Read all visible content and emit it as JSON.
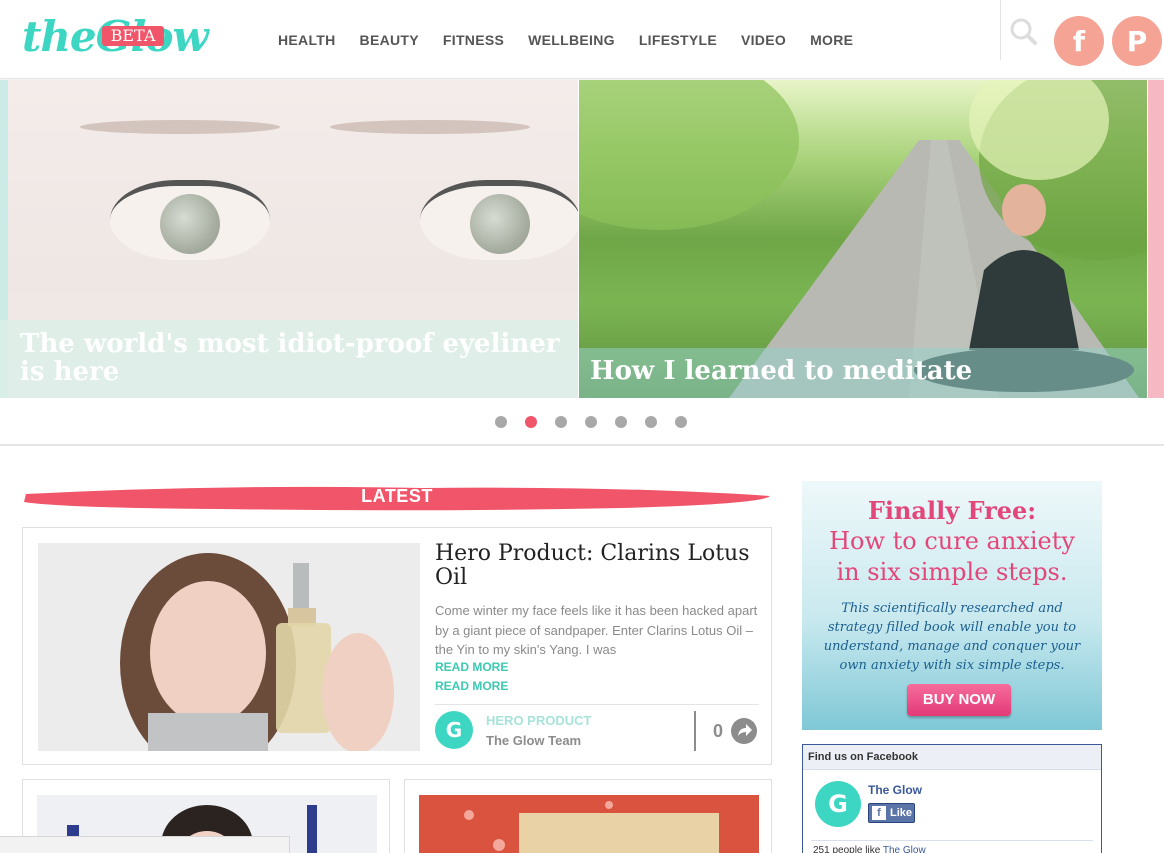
{
  "header": {
    "logo_text": "theGlow",
    "logo_badge": "BETA",
    "nav": [
      "HEALTH",
      "BEAUTY",
      "FITNESS",
      "WELLBEING",
      "LIFESTYLE",
      "VIDEO",
      "MORE"
    ],
    "social": {
      "facebook_icon": "f",
      "pinterest_icon": "P"
    }
  },
  "slider": {
    "slides": [
      {
        "caption": "The world's most idiot-proof eyeliner is here"
      },
      {
        "caption": "How I learned to meditate"
      }
    ],
    "dot_count": 7,
    "active_dot": 2
  },
  "latest": {
    "heading": "LATEST",
    "featured": {
      "title": "Hero Product: Clarins Lotus Oil",
      "excerpt": "Come winter my face feels like it has been hacked apart by a giant piece of sandpaper. Enter Clarins Lotus Oil – the Yin to my skin's Yang. I was",
      "read_more_1": "READ MORE",
      "read_more_2": "READ MORE",
      "avatar_letter": "G",
      "category": "HERO PRODUCT",
      "author": "The Glow Team",
      "share_count": "0"
    }
  },
  "ad": {
    "line1": "Finally Free:",
    "line2": "How to cure anxiety",
    "line3": "in six simple steps.",
    "body": "This scientifically researched and strategy filled book will enable you to understand, manage and conquer your own anxiety with six simple steps.",
    "button": "BUY NOW"
  },
  "facebook": {
    "header": "Find us on Facebook",
    "page_name": "The Glow",
    "avatar_letter": "G",
    "like_label": "Like",
    "like_f": "f",
    "count_text": "251 people like ",
    "count_link": "The Glow"
  },
  "colors": {
    "accent_pink": "#f0556a",
    "accent_teal": "#3dd6c3",
    "social_peach": "#f4a394"
  }
}
